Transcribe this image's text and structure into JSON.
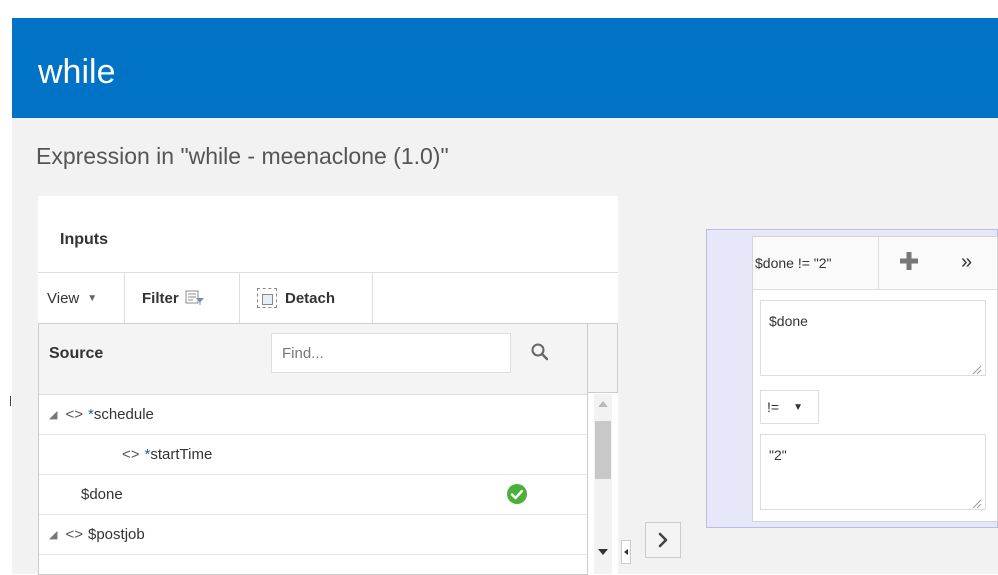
{
  "header": {
    "title": "while"
  },
  "subtitle": "Expression in \"while - meenaclone (1.0)\"",
  "inputs": {
    "label": "Inputs",
    "toolbar": {
      "view_label": "View",
      "filter_label": "Filter",
      "detach_label": "Detach"
    },
    "source_header": "Source",
    "find_placeholder": "Find...",
    "rows": [
      {
        "tag": "<>",
        "required": "*",
        "name": "schedule",
        "expanded": true
      },
      {
        "tag": "<>",
        "required": "*",
        "name": "startTime"
      },
      {
        "name": "$done",
        "status": "mapped"
      },
      {
        "tag": "<>",
        "name": "$postjob",
        "expanded": true
      }
    ]
  },
  "expression": {
    "tab_label": "$done != \"2\"",
    "left_operand": "$done",
    "operator": "!=",
    "right_operand": "\"2\""
  },
  "colors": {
    "header_bg": "#0073c6",
    "panel_bg": "#e6e8f9",
    "required": "#1560bd",
    "check": "#4caf38"
  },
  "icons": [
    "filter-icon",
    "detach-icon",
    "search-icon",
    "check-icon",
    "plus-icon",
    "double-chevron-right-icon",
    "chevron-right-icon"
  ]
}
